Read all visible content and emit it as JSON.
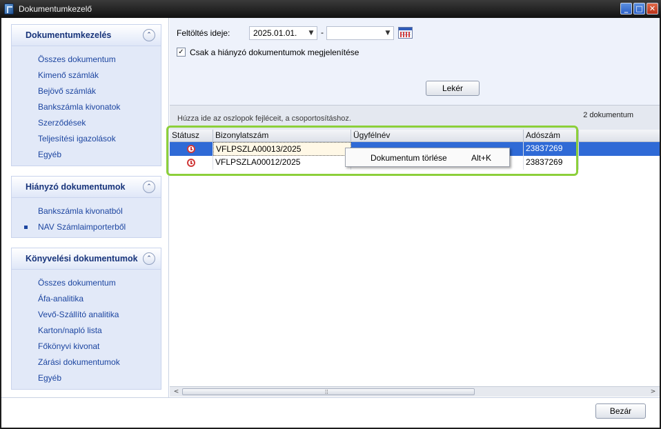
{
  "window": {
    "title": "Dokumentumkezelő",
    "buttons": {
      "minimize": "_",
      "maximize": "□",
      "close": "✕"
    }
  },
  "sidebar": {
    "groups": [
      {
        "title": "Dokumentumkezelés",
        "collapse_icon": "⌃",
        "items": [
          {
            "label": "Összes dokumentum"
          },
          {
            "label": "Kimenő számlák"
          },
          {
            "label": "Bejövő számlák"
          },
          {
            "label": "Bankszámla kivonatok"
          },
          {
            "label": "Szerződések"
          },
          {
            "label": "Teljesítési igazolások"
          },
          {
            "label": "Egyéb"
          }
        ]
      },
      {
        "title": "Hiányzó dokumentumok",
        "collapse_icon": "⌃",
        "items": [
          {
            "label": "Bankszámla kivonatból"
          },
          {
            "label": "NAV Számlaimporterből",
            "active": true
          }
        ]
      },
      {
        "title": "Könyvelési dokumentumok",
        "collapse_icon": "⌃",
        "items": [
          {
            "label": "Összes dokumentum"
          },
          {
            "label": "Áfa-analitika"
          },
          {
            "label": "Vevő-Szállító analitika"
          },
          {
            "label": "Karton/napló lista"
          },
          {
            "label": "Főkönyvi kivonat"
          },
          {
            "label": "Zárási dokumentumok"
          },
          {
            "label": "Egyéb"
          }
        ]
      }
    ]
  },
  "filters": {
    "upload_label": "Feltöltés ideje:",
    "date_from": "2025.01.01.",
    "date_to": "",
    "separator": "-",
    "missing_only_checked": true,
    "missing_only_label": "Csak a hiányzó dokumentumok megjelenítése",
    "fetch_button": "Lekér"
  },
  "grid": {
    "group_hint": "Húzza ide az oszlopok fejléceit, a csoportosításhoz.",
    "doc_count": "2 dokumentum",
    "columns": [
      "Státusz",
      "Bizonylatszám",
      "Ügyfélnév",
      "Adószám"
    ],
    "rows": [
      {
        "status_icon": "clock-icon",
        "doc_number": "VFLPSZLA00013/2025",
        "client": "",
        "tax_number": "23837269",
        "selected": true
      },
      {
        "status_icon": "clock-icon",
        "doc_number": "VFLPSZLA00012/2025",
        "client": "",
        "tax_number": "23837269",
        "selected": false
      }
    ]
  },
  "context_menu": {
    "item_label": "Dokumentum törlése",
    "item_shortcut": "Alt+K"
  },
  "scrollbar": {
    "left_arrow": "<",
    "right_arrow": ">",
    "grip": "⁞⁞"
  },
  "footer": {
    "close_button": "Bezár"
  },
  "colors": {
    "selection": "#2f6ad6",
    "highlight_border": "#8ccf3a",
    "sidebar_link": "#1c45a0",
    "group_title": "#17337a"
  }
}
